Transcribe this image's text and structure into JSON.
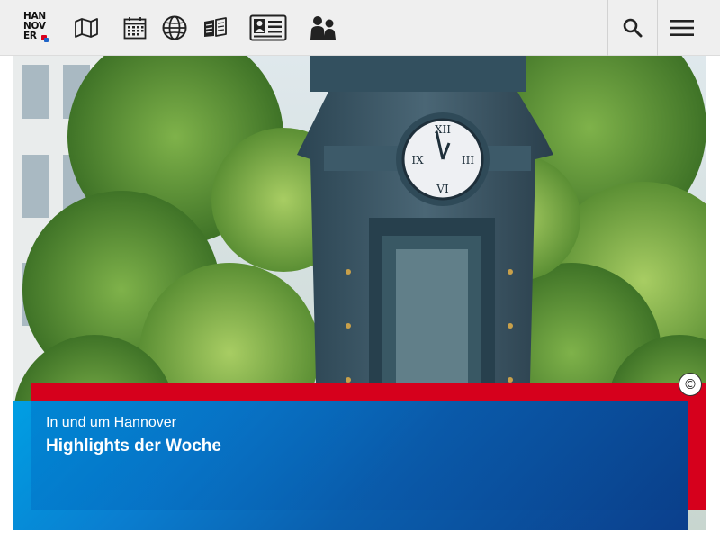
{
  "logo": {
    "line1": "HAN",
    "line2": "NOV",
    "line3": "ER"
  },
  "nav": {
    "items": [
      {
        "name": "map-icon"
      },
      {
        "name": "calendar-icon"
      },
      {
        "name": "globe-icon"
      },
      {
        "name": "book-icon"
      },
      {
        "name": "id-card-icon"
      },
      {
        "name": "people-icon"
      }
    ],
    "search_icon": "search-icon",
    "menu_icon": "hamburger-menu-icon"
  },
  "hero": {
    "copyright_symbol": "©",
    "subtitle": "In und um Hannover",
    "title": "Highlights der Woche"
  },
  "colors": {
    "header_bg": "#efefef",
    "accent_red": "#d6001c",
    "accent_blue": "#0a5fae",
    "accent_cyan": "#009fe3"
  }
}
